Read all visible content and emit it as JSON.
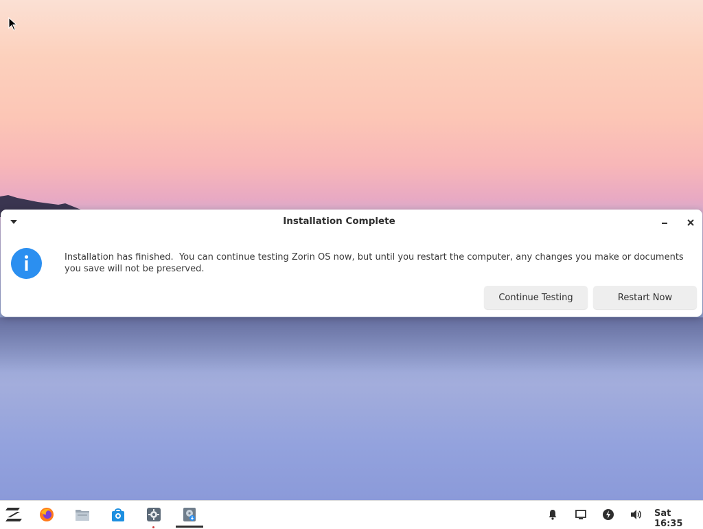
{
  "dialog": {
    "title": "Installation Complete",
    "message": "Installation has finished.  You can continue testing Zorin OS now, but until you restart the computer, any changes you make or documents you save will not be preserved.",
    "buttons": {
      "continue_label": "Continue Testing",
      "restart_label": "Restart Now"
    },
    "icon": "info-icon"
  },
  "taskbar": {
    "apps": [
      {
        "name": "zorin-menu",
        "icon": "zorin-logo-icon"
      },
      {
        "name": "firefox",
        "icon": "firefox-icon"
      },
      {
        "name": "files",
        "icon": "files-icon"
      },
      {
        "name": "software",
        "icon": "software-store-icon"
      },
      {
        "name": "settings",
        "icon": "settings-icon",
        "running": true
      },
      {
        "name": "installer",
        "icon": "installer-icon",
        "active": true
      }
    ],
    "tray": [
      {
        "name": "notifications",
        "icon": "bell-icon"
      },
      {
        "name": "display",
        "icon": "display-icon"
      },
      {
        "name": "power",
        "icon": "power-icon"
      },
      {
        "name": "volume",
        "icon": "speaker-icon"
      }
    ],
    "clock": "Sat 16:35"
  },
  "colors": {
    "accent": "#2b8ff0",
    "dialog_bg": "#ffffff",
    "button_bg": "#eeeeee",
    "taskbar_bg": "#ffffff"
  }
}
